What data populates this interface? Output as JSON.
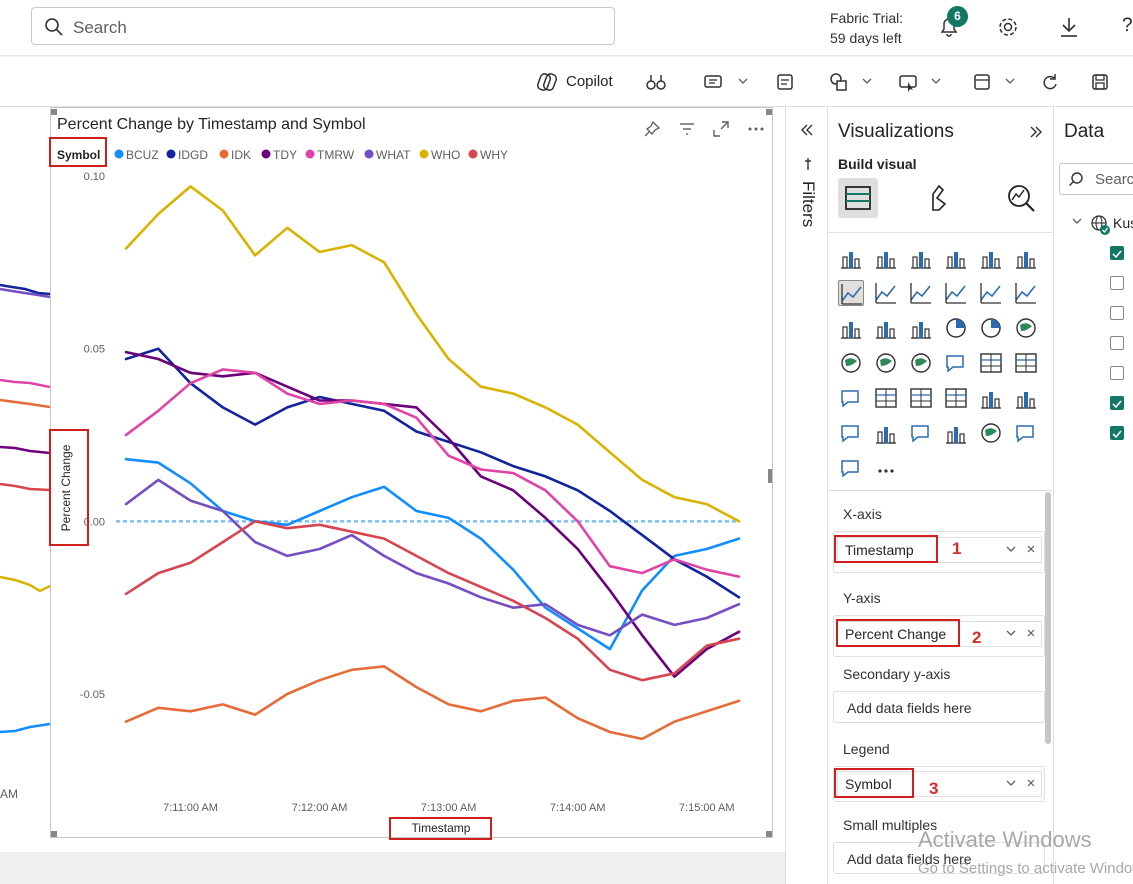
{
  "topbar": {
    "search_placeholder": "Search",
    "trial_line1": "Fabric Trial:",
    "trial_line2": "59 days left",
    "notification_count": "6",
    "help": "?"
  },
  "ribbon": {
    "copilot_label": "Copilot"
  },
  "visual": {
    "title": "Percent Change by Timestamp and Symbol",
    "legend_title": "Symbol",
    "y_axis_title": "Percent Change",
    "x_axis_title": "Timestamp",
    "left_partial_tick": "AM"
  },
  "chart_data": {
    "type": "line",
    "title": "Percent Change by Timestamp and Symbol",
    "xlabel": "Timestamp",
    "ylabel": "Percent Change",
    "legend_title": "Symbol",
    "legend_position": "top-left",
    "grid": false,
    "ylim": [
      -0.065,
      0.1
    ],
    "y_ticks": [
      "0.10",
      "0.05",
      "0.00",
      "-0.05"
    ],
    "x": [
      "7:10:30 AM",
      "7:10:45 AM",
      "7:11:00 AM",
      "7:11:15 AM",
      "7:11:30 AM",
      "7:11:45 AM",
      "7:12:00 AM",
      "7:12:15 AM",
      "7:12:30 AM",
      "7:12:45 AM",
      "7:13:00 AM",
      "7:13:15 AM",
      "7:13:30 AM",
      "7:13:45 AM",
      "7:14:00 AM",
      "7:14:15 AM",
      "7:14:30 AM",
      "7:14:45 AM",
      "7:15:00 AM",
      "7:15:15 AM"
    ],
    "x_ticks": [
      "7:11:00 AM",
      "7:12:00 AM",
      "7:13:00 AM",
      "7:14:00 AM",
      "7:15:00 AM"
    ],
    "reference_line": 0,
    "series": [
      {
        "name": "BCUZ",
        "color": "#118dff",
        "values": [
          0.018,
          0.017,
          0.011,
          0.003,
          0.0,
          -0.001,
          0.003,
          0.007,
          0.01,
          0.003,
          0.001,
          -0.005,
          -0.014,
          -0.025,
          -0.031,
          -0.037,
          -0.02,
          -0.01,
          -0.008,
          -0.005
        ]
      },
      {
        "name": "IDGD",
        "color": "#12239e",
        "values": [
          0.047,
          0.05,
          0.04,
          0.033,
          0.028,
          0.033,
          0.036,
          0.034,
          0.032,
          0.026,
          0.023,
          0.02,
          0.016,
          0.013,
          0.009,
          0.003,
          -0.004,
          -0.011,
          -0.016,
          -0.022
        ]
      },
      {
        "name": "IDK",
        "color": "#e66c37",
        "values": [
          -0.058,
          -0.054,
          -0.055,
          -0.053,
          -0.056,
          -0.05,
          -0.046,
          -0.043,
          -0.042,
          -0.048,
          -0.053,
          -0.055,
          -0.052,
          -0.051,
          -0.057,
          -0.061,
          -0.063,
          -0.058,
          -0.055,
          -0.052
        ]
      },
      {
        "name": "TDY",
        "color": "#6b007b",
        "values": [
          0.049,
          0.047,
          0.043,
          0.042,
          0.043,
          0.039,
          0.035,
          0.035,
          0.034,
          0.033,
          0.024,
          0.013,
          0.009,
          0.001,
          -0.008,
          -0.02,
          -0.033,
          -0.045,
          -0.037,
          -0.032
        ]
      },
      {
        "name": "TMRW",
        "color": "#e044a7",
        "values": [
          0.025,
          0.032,
          0.04,
          0.044,
          0.043,
          0.037,
          0.034,
          0.035,
          0.034,
          0.03,
          0.019,
          0.015,
          0.014,
          0.009,
          0.0,
          -0.013,
          -0.015,
          -0.011,
          -0.014,
          -0.016
        ]
      },
      {
        "name": "WHAT",
        "color": "#744ec2",
        "values": [
          0.005,
          0.012,
          0.006,
          0.003,
          -0.006,
          -0.01,
          -0.008,
          -0.004,
          -0.01,
          -0.015,
          -0.018,
          -0.022,
          -0.025,
          -0.024,
          -0.03,
          -0.033,
          -0.027,
          -0.03,
          -0.028,
          -0.024
        ]
      },
      {
        "name": "WHO",
        "color": "#d9b300",
        "values": [
          0.079,
          0.089,
          0.097,
          0.09,
          0.077,
          0.085,
          0.078,
          0.08,
          0.075,
          0.06,
          0.047,
          0.039,
          0.037,
          0.033,
          0.028,
          0.02,
          0.012,
          0.007,
          0.005,
          0.0
        ]
      },
      {
        "name": "WHY",
        "color": "#d64550",
        "values": [
          -0.021,
          -0.015,
          -0.012,
          -0.006,
          0.0,
          -0.002,
          -0.001,
          -0.003,
          -0.005,
          -0.01,
          -0.015,
          -0.019,
          -0.023,
          -0.028,
          -0.034,
          -0.043,
          -0.046,
          -0.044,
          -0.036,
          -0.034
        ]
      }
    ]
  },
  "filters": {
    "label": "Filters"
  },
  "visualizations": {
    "title": "Visualizations",
    "build_visual": "Build visual",
    "x_axis_label": "X-axis",
    "x_axis_field": "Timestamp",
    "x_axis_num": "1",
    "y_axis_label": "Y-axis",
    "y_axis_field": "Percent Change",
    "y_axis_num": "2",
    "secondary_y_label": "Secondary y-axis",
    "add_fields": "Add data fields here",
    "legend_label": "Legend",
    "legend_field": "Symbol",
    "legend_num": "3",
    "small_multiples_label": "Small multiples",
    "more": "..."
  },
  "data_pane": {
    "title": "Data",
    "search_placeholder": "Search",
    "tree_item": "Kus"
  },
  "watermark": {
    "line1": "Activate Windows",
    "line2": "Go to Settings to activate Windows."
  }
}
